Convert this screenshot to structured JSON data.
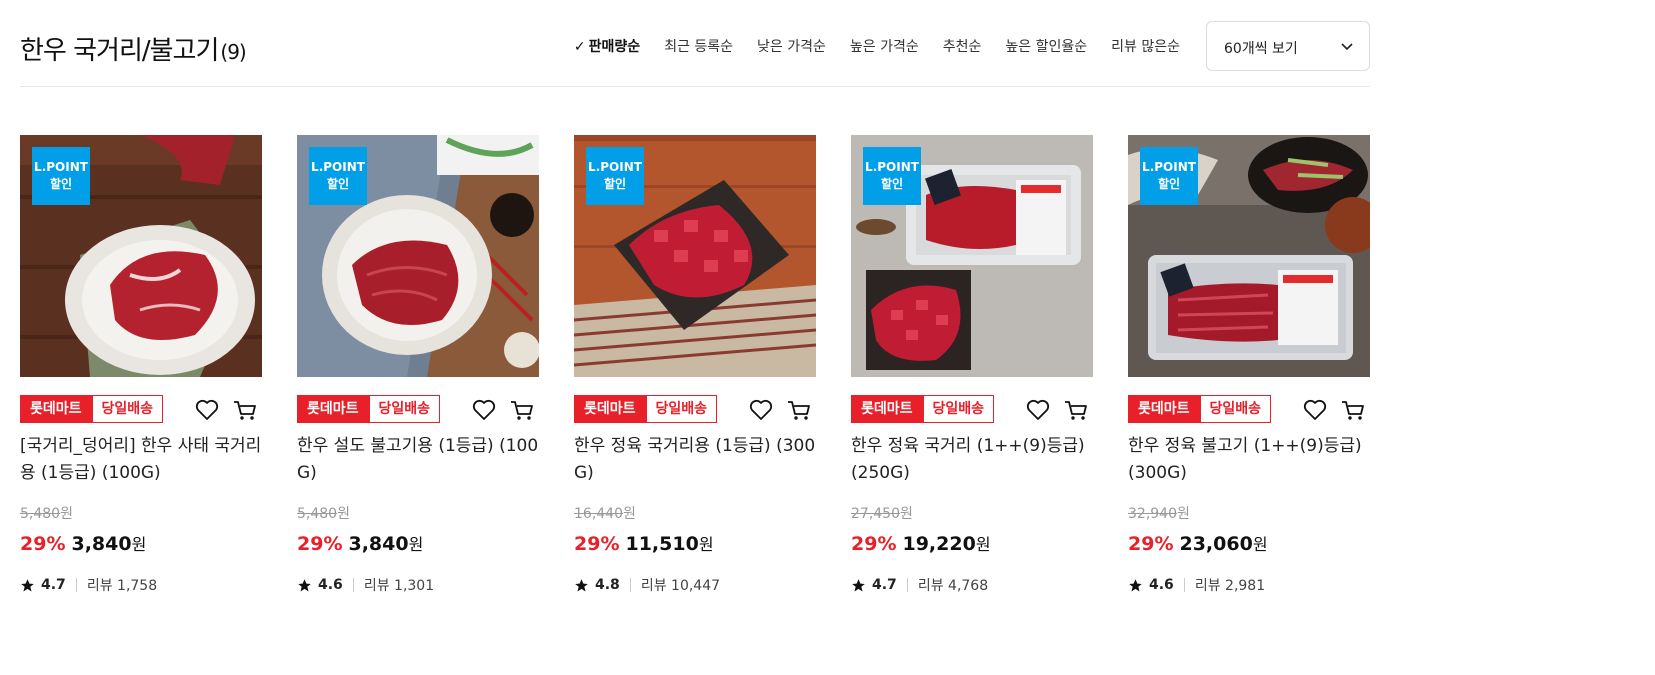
{
  "header": {
    "title": "한우 국거리/불고기",
    "count": "(9)"
  },
  "sorts": [
    {
      "label": "판매량순",
      "active": true
    },
    {
      "label": "최근 등록순",
      "active": false
    },
    {
      "label": "낮은 가격순",
      "active": false
    },
    {
      "label": "높은 가격순",
      "active": false
    },
    {
      "label": "추천순",
      "active": false
    },
    {
      "label": "높은 할인율순",
      "active": false
    },
    {
      "label": "리뷰 많은순",
      "active": false
    }
  ],
  "page_size": {
    "selected": "60개씩 보기"
  },
  "badge": {
    "line1": "L.POINT",
    "line2": "할인"
  },
  "tags": {
    "mart": "롯데마트",
    "ship": "당일배송"
  },
  "currency": "원",
  "review_label": "리뷰",
  "products": [
    {
      "name": "[국거리_덩어리] 한우 사태 국거리용 (1등급) (100G)",
      "original_price": "5,480",
      "discount_rate": "29%",
      "price": "3,840",
      "rating": "4.7",
      "reviews": "1,758"
    },
    {
      "name": "한우 설도 불고기용 (1등급) (100G)",
      "original_price": "5,480",
      "discount_rate": "29%",
      "price": "3,840",
      "rating": "4.6",
      "reviews": "1,301"
    },
    {
      "name": "한우 정육 국거리용 (1등급) (300G)",
      "original_price": "16,440",
      "discount_rate": "29%",
      "price": "11,510",
      "rating": "4.8",
      "reviews": "10,447"
    },
    {
      "name": "한우 정육 국거리 (1++(9)등급) (250G)",
      "original_price": "27,450",
      "discount_rate": "29%",
      "price": "19,220",
      "rating": "4.7",
      "reviews": "4,768"
    },
    {
      "name": "한우 정육 불고기 (1++(9)등급) (300G)",
      "original_price": "32,940",
      "discount_rate": "29%",
      "price": "23,060",
      "rating": "4.6",
      "reviews": "2,981"
    }
  ],
  "colors": {
    "accent": "#e8202a",
    "lpoint": "#009fe8"
  }
}
